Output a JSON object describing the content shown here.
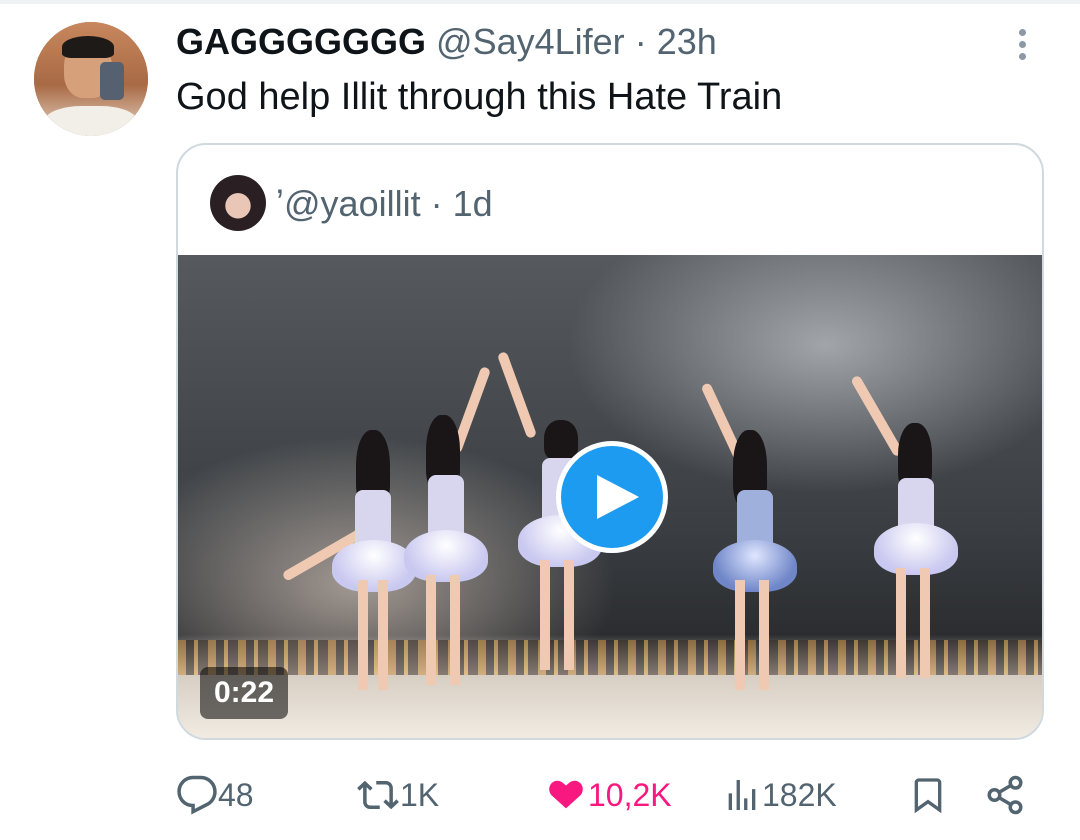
{
  "tweet": {
    "display_name": "GAGGGGGGG",
    "handle": "@Say4Lifer",
    "separator": "·",
    "time": "23h",
    "text": "God help Illit through this Hate Train"
  },
  "quoted": {
    "prefix": "ʼ",
    "handle": "@yaoillit",
    "separator": "·",
    "time": "1d",
    "video_duration": "0:22"
  },
  "actions": {
    "replies": "48",
    "reposts": "1K",
    "likes": "10,2K",
    "views": "182K"
  },
  "colors": {
    "accent": "#1d9bf0",
    "like": "#f91880",
    "muted": "#536471"
  },
  "icons": [
    "more-icon",
    "reply-icon",
    "repost-icon",
    "heart-icon",
    "views-icon",
    "bookmark-icon",
    "share-icon",
    "play-icon"
  ]
}
